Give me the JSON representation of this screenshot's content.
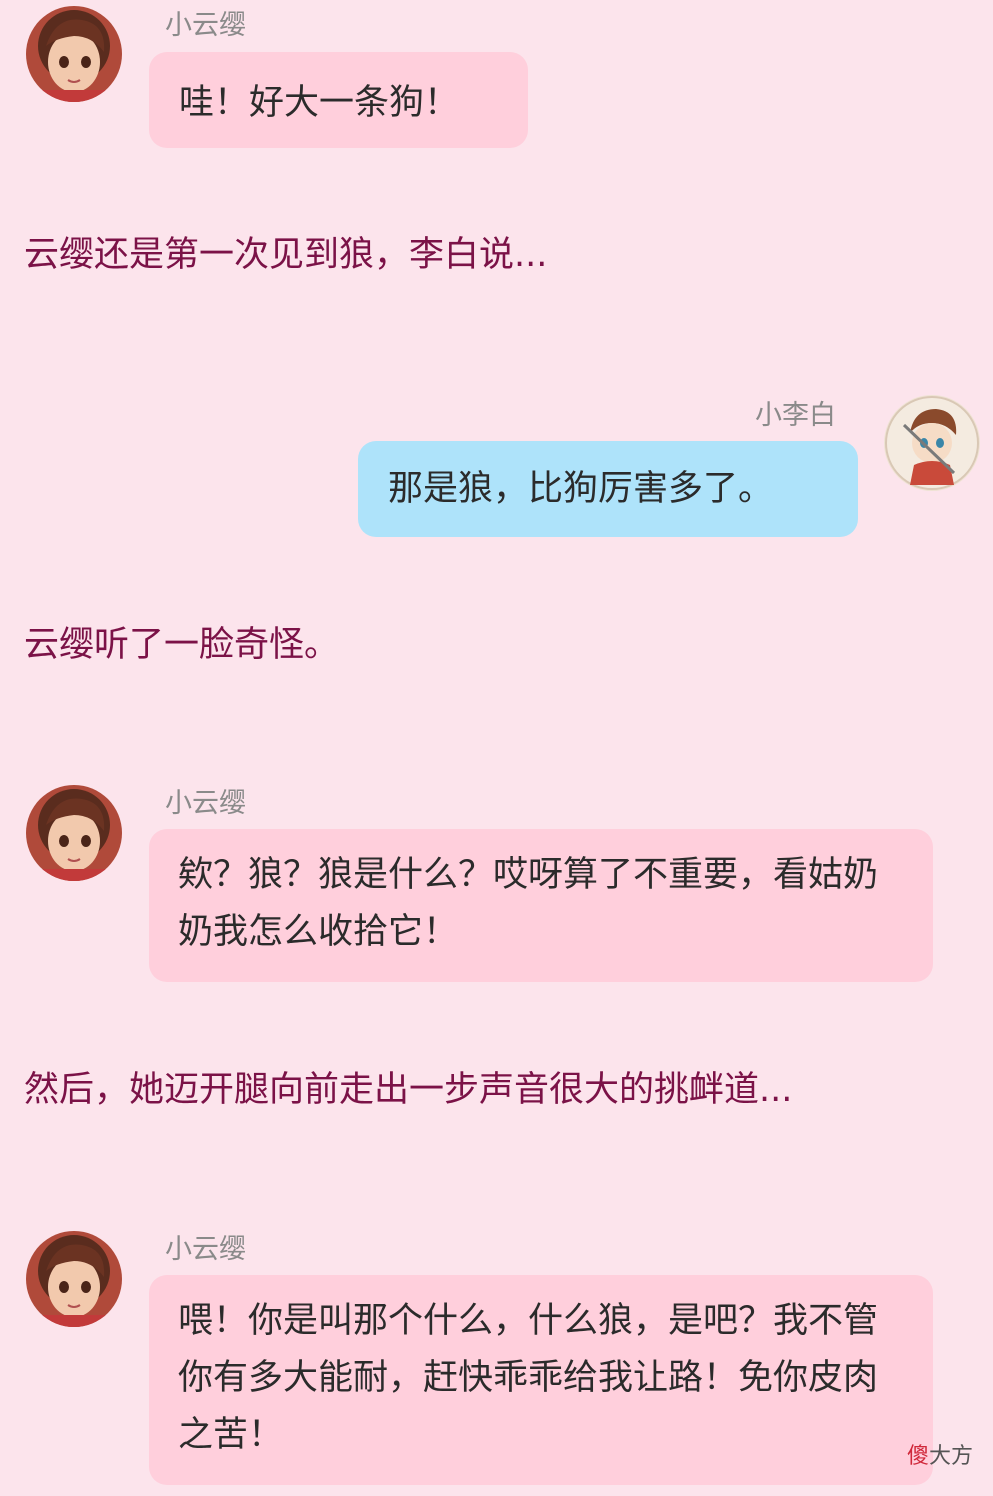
{
  "characters": {
    "yunying": {
      "name": "小云缨",
      "avatar_icon": "yunying-avatar-icon"
    },
    "libai": {
      "name": "小李白",
      "avatar_icon": "libai-avatar-icon"
    }
  },
  "messages": [
    {
      "type": "bubble",
      "speaker": "小云缨",
      "text": "哇！好大一条狗！"
    },
    {
      "type": "narration",
      "text": "云缨还是第一次见到狼，李白说..."
    },
    {
      "type": "bubble",
      "speaker": "小李白",
      "text": "那是狼，比狗厉害多了。"
    },
    {
      "type": "narration",
      "text": "云缨听了一脸奇怪。"
    },
    {
      "type": "bubble",
      "speaker": "小云缨",
      "text": "欸？狼？狼是什么？哎呀算了不重要，看姑奶奶我怎么收拾它！"
    },
    {
      "type": "narration",
      "text": "然后，她迈开腿向前走出一步声音很大的挑衅道..."
    },
    {
      "type": "bubble",
      "speaker": "小云缨",
      "text": "喂！你是叫那个什么，什么狼，是吧？我不管你有多大能耐，赶快乖乖给我让路！免你皮肉之苦！"
    }
  ],
  "watermark": {
    "part1": "傻",
    "part2": "大方"
  },
  "colors": {
    "background": "#fce4ec",
    "pink_bubble": "#ffcfdc",
    "blue_bubble": "#aee3fa",
    "narration_text": "#7b1247",
    "name_text": "#8a8a8a"
  }
}
